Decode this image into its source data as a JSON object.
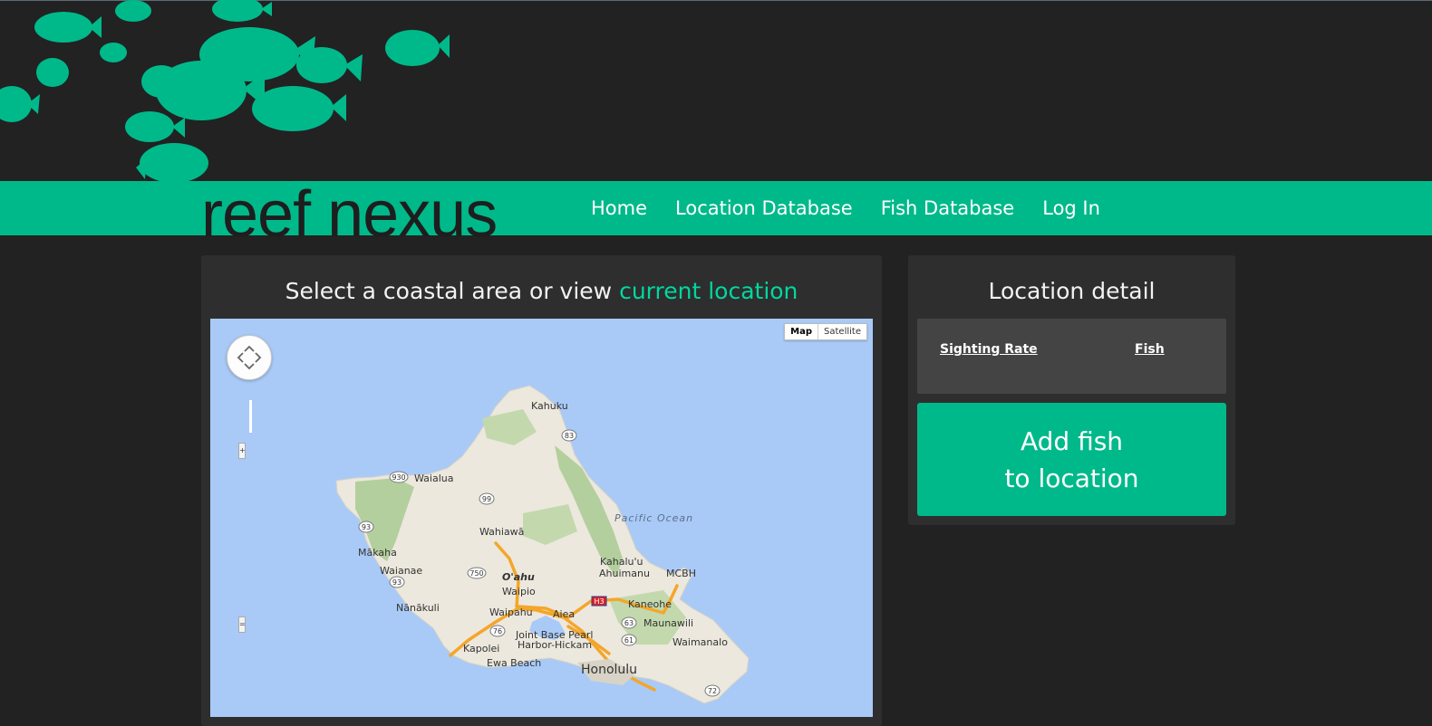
{
  "brand": "reef nexus",
  "nav": {
    "items": [
      "Home",
      "Location Database",
      "Fish Database",
      "Log In"
    ]
  },
  "map_panel": {
    "title_prefix": "Select a coastal area or view ",
    "title_link": "current location",
    "map_type": {
      "map": "Map",
      "satellite": "Satellite"
    },
    "labels": {
      "kahuku": "Kahuku",
      "waialua": "Waialua",
      "wahiawa": "Wahiawā",
      "oahu": "O'ahu",
      "makaha": "Mākaha",
      "waianae": "Waianae",
      "nanakuli": "Nānākuli",
      "waipio": "Waipio",
      "waipahu": "Waipahu",
      "aiea": "Aiea",
      "kapolei": "Kapolei",
      "ewa_beach": "Ewa Beach",
      "jbph_1": "Joint Base Pearl",
      "jbph_2": "Harbor-Hickam",
      "honolulu": "Honolulu",
      "kahaluu": "Kahalu'u",
      "ahuimanu": "Ahuimanu",
      "mcbh": "MCBH",
      "kaneohe": "Kaneohe",
      "maunawili": "Maunawili",
      "waimanalo": "Waimanalo",
      "pacific_ocean": "Pacific Ocean"
    },
    "shields": {
      "r83": "83",
      "r930": "930",
      "r99": "99",
      "r93a": "93",
      "r750": "750",
      "r93b": "93",
      "h3": "H3",
      "r63": "63",
      "r61": "61",
      "r76": "76",
      "r72": "72"
    }
  },
  "detail_panel": {
    "title": "Location detail",
    "columns": [
      "Sighting Rate",
      "Fish"
    ],
    "add_button": [
      "Add fish",
      "to location"
    ]
  },
  "colors": {
    "accent": "#00b98a",
    "accent_link": "#00d8a0",
    "background": "#222222",
    "panel": "#2e2e2e",
    "ocean": "#a9caf7"
  }
}
